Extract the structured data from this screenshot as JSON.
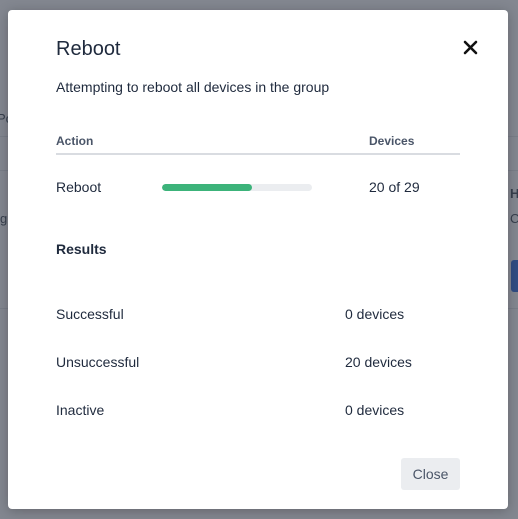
{
  "background": {
    "fragments": [
      "Po",
      "g",
      "H",
      "C"
    ]
  },
  "modal": {
    "title": "Reboot",
    "subtitle": "Attempting to reboot all devices in the group",
    "table": {
      "headers": [
        "Action",
        "Devices"
      ],
      "rows": [
        {
          "action": "Reboot",
          "progress": 0.6,
          "devices": "20 of 29"
        }
      ]
    },
    "results": {
      "heading": "Results",
      "items": [
        {
          "label": "Successful",
          "value": "0 devices"
        },
        {
          "label": "Unsuccessful",
          "value": "20 devices"
        },
        {
          "label": "Inactive",
          "value": "0 devices"
        }
      ]
    },
    "close_label": "Close"
  },
  "colors": {
    "progress_fill": "#3cb37a",
    "progress_track": "#ebedf0",
    "overlay": "#3e4450"
  },
  "icons": {
    "close": "close-icon"
  }
}
